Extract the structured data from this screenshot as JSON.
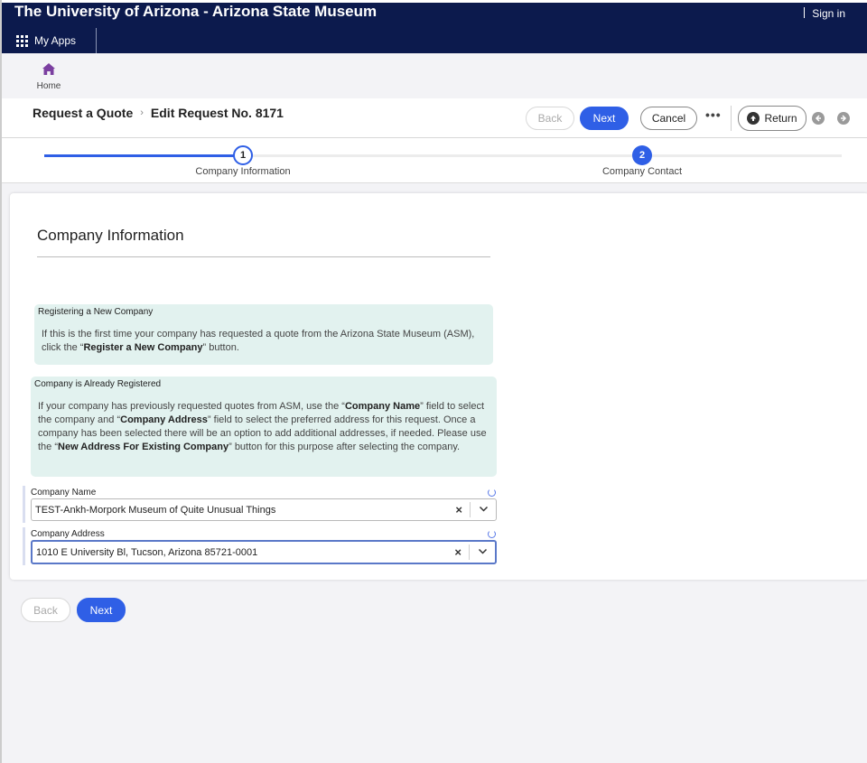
{
  "header": {
    "site_title": "The University of Arizona - Arizona State Museum",
    "sign_in": "Sign in",
    "my_apps": "My Apps",
    "home": "Home"
  },
  "page": {
    "breadcrumb": [
      "Request a Quote",
      "Edit Request No. 8171"
    ],
    "actions": {
      "back": "Back",
      "next": "Next",
      "cancel": "Cancel",
      "more": "•••",
      "return": "Return"
    }
  },
  "steps": [
    {
      "number": "1",
      "label": "Company Information",
      "state": "current"
    },
    {
      "number": "2",
      "label": "Company Contact",
      "state": "upcoming"
    }
  ],
  "form": {
    "title": "Company Information",
    "info_new": {
      "title": "Registering a New Company",
      "text_before": "If this is the first time your company has requested a quote from the Arizona State Museum (ASM), click the “",
      "bold": "Register a New Company",
      "text_after": "” button."
    },
    "info_existing": {
      "title": "Company is Already Registered",
      "p1": "If your company has previously requested quotes from ASM, use the “",
      "b1": "Company Name",
      "p2": "” field to select the company and “",
      "b2": "Company Address",
      "p3": "” field to select the preferred address for this request. Once a company has been selected there will be an option to add additional addresses, if needed. Please use the “",
      "b3": "New Address For Existing Company",
      "p4": "” button for this purpose after selecting the company."
    },
    "company_name": {
      "label": "Company Name",
      "value": "TEST-Ankh-Morpork Museum of Quite Unusual Things"
    },
    "company_address": {
      "label": "Company Address",
      "value": "1010 E University Bl, Tucson, Arizona 85721-0001"
    }
  },
  "footer": {
    "back": "Back",
    "next": "Next"
  },
  "colors": {
    "navy": "#0c1a4d",
    "primary": "#2f5fe6",
    "info_bg": "#e2f2ef",
    "home_icon": "#7b3fa0"
  }
}
